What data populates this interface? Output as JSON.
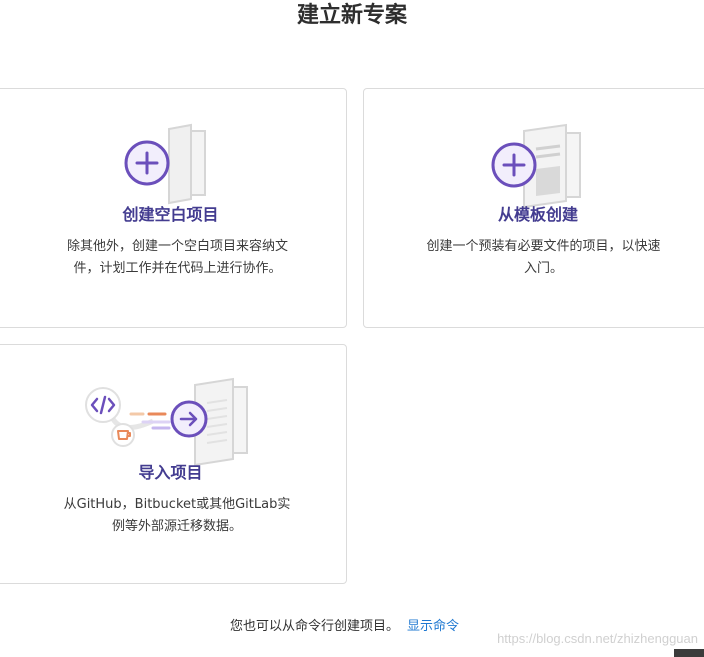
{
  "page": {
    "title": "建立新专案"
  },
  "cards": {
    "blank": {
      "title": "创建空白项目",
      "description": "除其他外，创建一个空白项目来容纳文件，计划工作并在代码上进行协作。"
    },
    "template": {
      "title": "从模板创建",
      "description": "创建一个预装有必要文件的项目，以快速入门。"
    },
    "import": {
      "title": "导入项目",
      "description": "从GitHub，Bitbucket或其他GitLab实例等外部源迁移数据。"
    }
  },
  "footer": {
    "text": "您也可以从命令行创建项目。",
    "link": "显示命令"
  },
  "watermark": "https://blog.csdn.net/zhizhengguan",
  "colors": {
    "accent": "#6b4fbb",
    "title_text": "#433c90",
    "link": "#1f78d1",
    "border": "#dbdbdb"
  },
  "icons": [
    "plus-icon",
    "document-icon",
    "template-document-icon",
    "code-icon",
    "gitlab-icon",
    "arrow-right-icon"
  ]
}
